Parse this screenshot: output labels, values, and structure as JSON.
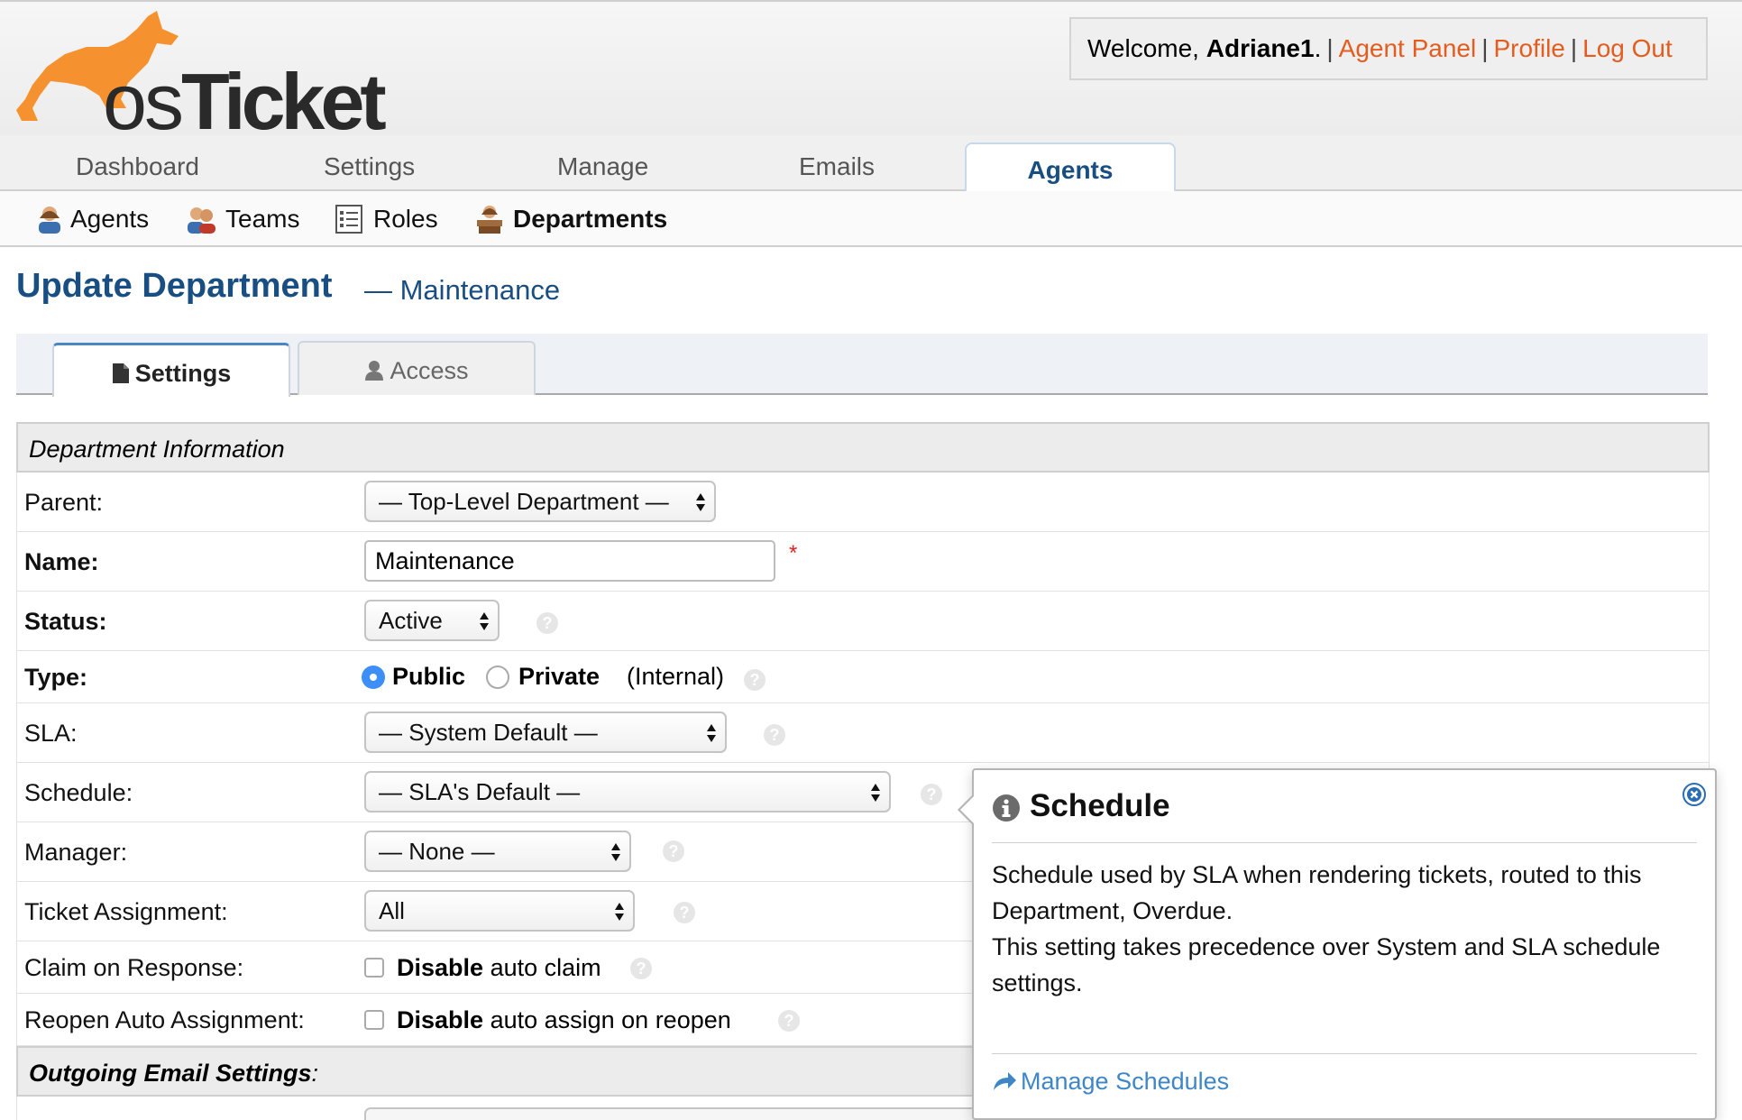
{
  "header": {
    "logo_text_os": "os",
    "logo_text_ticket": "Ticket",
    "welcome_prefix": "Welcome, ",
    "username": "Adriane1",
    "welcome_suffix": ".",
    "links": [
      "Agent Panel",
      "Profile",
      "Log Out"
    ]
  },
  "main_nav": {
    "tabs": [
      "Dashboard",
      "Settings",
      "Manage",
      "Emails",
      "Agents"
    ],
    "active": "Agents"
  },
  "sub_nav": {
    "items": [
      "Agents",
      "Teams",
      "Roles",
      "Departments"
    ],
    "active": "Departments"
  },
  "page": {
    "title": "Update Department",
    "subtitle": "— Maintenance"
  },
  "form_tabs": {
    "settings": "Settings",
    "access": "Access"
  },
  "section1": {
    "title": "Department Information"
  },
  "fields": {
    "parent": {
      "label": "Parent:",
      "value": "— Top-Level Department —"
    },
    "name": {
      "label": "Name:",
      "value": "Maintenance",
      "required": "*"
    },
    "status": {
      "label": "Status:",
      "value": "Active"
    },
    "type": {
      "label": "Type:",
      "public": "Public",
      "private": "Private",
      "private_note": "(Internal)",
      "selected": "Public"
    },
    "sla": {
      "label": "SLA:",
      "value": "— System Default —"
    },
    "schedule": {
      "label": "Schedule:",
      "value": "— SLA's Default —"
    },
    "manager": {
      "label": "Manager:",
      "value": "— None —"
    },
    "ticket_assignment": {
      "label": "Ticket Assignment:",
      "value": "All"
    },
    "claim_on_response": {
      "label": "Claim on Response:",
      "bold": "Disable",
      "text": "auto claim"
    },
    "reopen_auto_assignment": {
      "label": "Reopen Auto Assignment:",
      "bold": "Disable",
      "text": "auto assign on reopen"
    }
  },
  "section2": {
    "title": "Outgoing Email Settings",
    "colon": ":"
  },
  "popover": {
    "title": "Schedule",
    "body1": "Schedule used by SLA when rendering tickets, routed to this Department, Overdue.",
    "body2": "This setting takes precedence over System and SLA schedule settings.",
    "link": "Manage Schedules"
  },
  "colors": {
    "accent_blue": "#184e81",
    "link_orange": "#e45c1e",
    "link_blue": "#3f86c6",
    "kangaroo_orange": "#f5922f"
  }
}
